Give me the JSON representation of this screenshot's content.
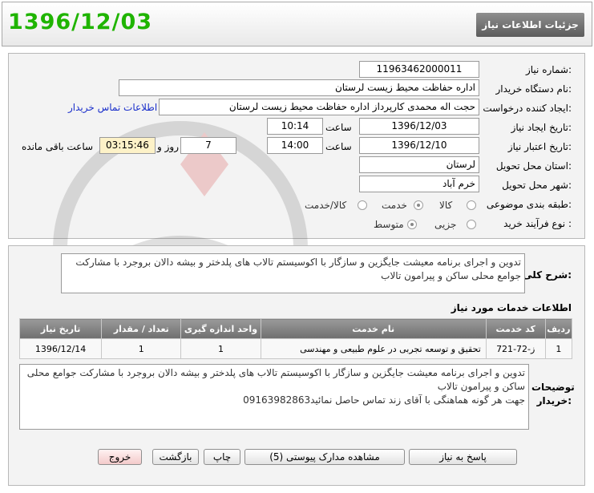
{
  "header": {
    "date_stamp": "1396/12/03",
    "title": "جزئیات اطلاعات نیاز"
  },
  "form": {
    "need_number": {
      "label": "شماره نیاز:",
      "value": "11963462000011"
    },
    "buyer_org": {
      "label": "نام دستگاه خریدار:",
      "value": "اداره حفاظت محیط زیست لرستان"
    },
    "requester": {
      "label": "ایجاد کننده درخواست:",
      "value": "حجت اله محمدی کارپرداز اداره حفاظت محیط زیست لرستان",
      "contact_link": "اطلاعات تماس خریدار"
    },
    "created": {
      "label": "تاریخ ایجاد نیاز:",
      "date": "1396/12/03",
      "time_label": "ساعت",
      "time": "10:14"
    },
    "validity": {
      "label": "تاریخ اعتبار نیاز:",
      "date": "1396/12/10",
      "time_label": "ساعت",
      "time": "14:00",
      "days": "7",
      "days_label": "روز و",
      "remaining": "03:15:46",
      "remaining_label": "ساعت باقی مانده"
    },
    "province": {
      "label": "استان محل تحویل:",
      "value": "لرستان"
    },
    "city": {
      "label": "شهر محل تحویل:",
      "value": "خرم آباد"
    },
    "category": {
      "label": "طبقه بندی موضوعی:",
      "options": [
        "کالا",
        "خدمت",
        "کالا/خدمت"
      ],
      "selected": "خدمت"
    },
    "process": {
      "label": "نوع فرآیند خرید :",
      "options": [
        "جزیی",
        "متوسط"
      ],
      "selected": "متوسط"
    }
  },
  "description": {
    "label": "شرح کلی نیاز:",
    "text": "تدوین و اجرای برنامه معیشت جایگزین و سازگار با اکوسیستم تالاب های پلدختر و بیشه دالان بروجرد با مشارکت جوامع محلی ساکن و پیرامون تالاب"
  },
  "services": {
    "title": "اطلاعات خدمات مورد نیاز",
    "columns": [
      "ردیف",
      "کد خدمت",
      "نام خدمت",
      "واحد اندازه گیری",
      "تعداد / مقدار",
      "تاریخ نیاز"
    ],
    "rows": [
      [
        "1",
        "ز-72-721",
        "تحقیق و توسعه تجربی در علوم طبیعی و مهندسی",
        "1",
        "1",
        "1396/12/14"
      ]
    ]
  },
  "buyer_notes": {
    "label": "توضیحات خریدار:",
    "line1": "تدوین و اجرای برنامه معیشت جایگزین و سازگار با اکوسیستم تالاب های پلدختر و بیشه دالان بروجرد با مشارکت جوامع محلی ساکن و پیرامون تالاب",
    "line2": "جهت هر گونه هماهنگی با آقای زند تماس حاصل نمائید09163982863"
  },
  "buttons": {
    "reply": "پاسخ به نیاز",
    "attachments": "مشاهده مدارک پیوستی (5)",
    "print": "چاپ",
    "back": "بازگشت",
    "exit": "خروج"
  },
  "colors": {
    "date_green": "#1fb400",
    "link_blue": "#1a2fcb",
    "timer_bg": "#fdf2c8"
  }
}
